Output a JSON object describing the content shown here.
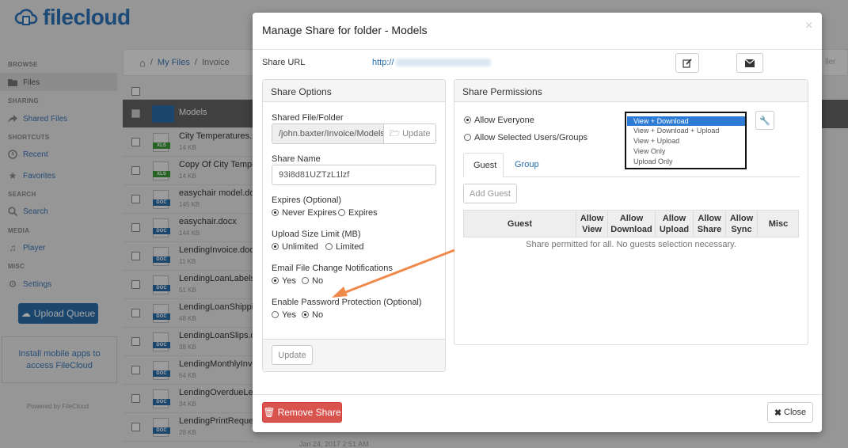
{
  "app": {
    "brand": "filecloud"
  },
  "sidebar": {
    "sections": [
      {
        "heading": "BROWSE",
        "items": [
          {
            "label": "Files",
            "icon": "folder-icon"
          }
        ]
      },
      {
        "heading": "SHARING",
        "items": [
          {
            "label": "Shared Files",
            "icon": "share-icon"
          }
        ]
      },
      {
        "heading": "SHORTCUTS",
        "items": [
          {
            "label": "Recent",
            "icon": "clock-icon"
          },
          {
            "label": "Favorites",
            "icon": "star-icon"
          }
        ]
      },
      {
        "heading": "SEARCH",
        "items": [
          {
            "label": "Search",
            "icon": "search-icon"
          }
        ]
      },
      {
        "heading": "MEDIA",
        "items": [
          {
            "label": "Player",
            "icon": "music-icon"
          }
        ]
      },
      {
        "heading": "MISC",
        "items": [
          {
            "label": "Settings",
            "icon": "gear-icon"
          }
        ]
      }
    ],
    "upload_queue": "Upload Queue",
    "mobile_apps": "Install mobile apps to access FileCloud",
    "powered_by": "Powered by FileCloud"
  },
  "breadcrumb": {
    "my_files": "My Files",
    "separator": "/",
    "current": "Invoice"
  },
  "right_peek": "ller",
  "files": [
    {
      "name": "Models",
      "size": "",
      "type": "folder",
      "selected": true
    },
    {
      "name": "City Temperatures.xl",
      "size": "14 KB",
      "type": "XLS"
    },
    {
      "name": "Copy Of City Temper",
      "size": "14 KB",
      "type": "XLS"
    },
    {
      "name": "easychair model.doc",
      "size": "145 KB",
      "type": "DOC"
    },
    {
      "name": "easychair.docx",
      "size": "144 KB",
      "type": "DOC"
    },
    {
      "name": "LendingInvoice.doc",
      "size": "11 KB",
      "type": "DOC"
    },
    {
      "name": "LendingLoanLabels.d",
      "size": "51 KB",
      "type": "DOC"
    },
    {
      "name": "LendingLoanShippin",
      "size": "48 KB",
      "type": "DOC"
    },
    {
      "name": "LendingLoanSlips.do",
      "size": "38 KB",
      "type": "DOC"
    },
    {
      "name": "LendingMonthlyInvo",
      "size": "64 KB",
      "type": "DOC"
    },
    {
      "name": "LendingOverdueLett",
      "size": "34 KB",
      "type": "DOC"
    },
    {
      "name": "LendingPrintRequest.doc",
      "size": "28 KB",
      "type": "DOC"
    }
  ],
  "last_date": "Jan 24, 2017 2:51 AM",
  "modal": {
    "title": "Manage Share for folder - Models",
    "share_url_label": "Share URL",
    "share_url_value": "http://",
    "share_options": {
      "heading": "Share Options",
      "shared_path_label": "Shared File/Folder",
      "shared_path_value": "/john.baxter/Invoice/Models",
      "update_path_btn": "Update",
      "share_name_label": "Share Name",
      "share_name_value": "93i8d81UZTzL1lzf",
      "expires_label": "Expires (Optional)",
      "expires_opt1": "Never Expires",
      "expires_opt2": "Expires",
      "upload_limit_label": "Upload Size Limit (MB)",
      "upload_opt1": "Unlimited",
      "upload_opt2": "Limited",
      "email_label": "Email File Change Notifications",
      "email_opt1": "Yes",
      "email_opt2": "No",
      "password_label": "Enable Password Protection (Optional)",
      "password_opt1": "Yes",
      "password_opt2": "No",
      "update_btn": "Update"
    },
    "permissions": {
      "heading": "Share Permissions",
      "allow_everyone": "Allow Everyone",
      "allow_selected": "Allow Selected Users/Groups",
      "dropdown_options": [
        "View + Download",
        "View + Download + Upload",
        "View + Upload",
        "View Only",
        "Upload Only"
      ],
      "tabs": [
        "Guest",
        "Group"
      ],
      "add_guest": "Add Guest",
      "columns": [
        "Guest",
        "Allow View",
        "Allow Download",
        "Allow Upload",
        "Allow Share",
        "Allow Sync",
        "Misc"
      ],
      "empty_msg": "Share permitted for all. No guests selection necessary."
    },
    "remove_share": "Remove Share",
    "close": "Close"
  },
  "colors": {
    "brand": "#2a70b8",
    "danger": "#d9534f",
    "arrow": "#f08a4b",
    "selected_option": "#2d7bd5"
  }
}
